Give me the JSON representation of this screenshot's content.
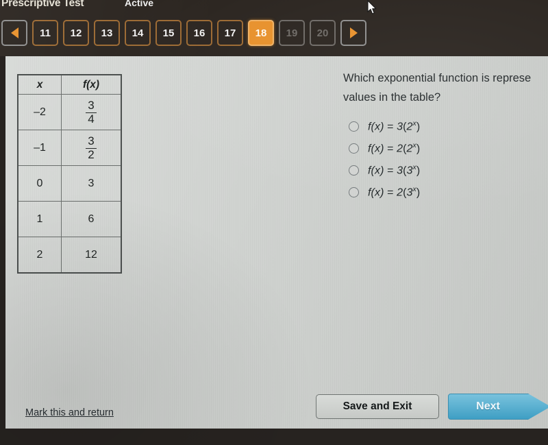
{
  "header": {
    "test_title": "Prescriptive Test",
    "status": "Active"
  },
  "pager": {
    "prev_label": "prev",
    "next_label": "next",
    "items": [
      {
        "label": "11",
        "state": "available"
      },
      {
        "label": "12",
        "state": "available"
      },
      {
        "label": "13",
        "state": "available"
      },
      {
        "label": "14",
        "state": "available"
      },
      {
        "label": "15",
        "state": "available"
      },
      {
        "label": "16",
        "state": "available"
      },
      {
        "label": "17",
        "state": "available"
      },
      {
        "label": "18",
        "state": "current"
      },
      {
        "label": "19",
        "state": "disabled"
      },
      {
        "label": "20",
        "state": "disabled"
      }
    ]
  },
  "table": {
    "headers": [
      "x",
      "f(x)"
    ],
    "rows": [
      {
        "x": "–2",
        "fx_num": "3",
        "fx_den": "4",
        "fx_plain": ""
      },
      {
        "x": "–1",
        "fx_num": "3",
        "fx_den": "2",
        "fx_plain": ""
      },
      {
        "x": "0",
        "fx_num": "",
        "fx_den": "",
        "fx_plain": "3"
      },
      {
        "x": "1",
        "fx_num": "",
        "fx_den": "",
        "fx_plain": "6"
      },
      {
        "x": "2",
        "fx_num": "",
        "fx_den": "",
        "fx_plain": "12"
      }
    ]
  },
  "question": {
    "line1": "Which exponential function is represe",
    "line2": "values in the table?",
    "choices": [
      {
        "id": "a",
        "coefficient": "3",
        "base": "2",
        "selected": false
      },
      {
        "id": "b",
        "coefficient": "2",
        "base": "2",
        "selected": false
      },
      {
        "id": "c",
        "coefficient": "3",
        "base": "3",
        "selected": false
      },
      {
        "id": "d",
        "coefficient": "2",
        "base": "3",
        "selected": false
      }
    ]
  },
  "footer": {
    "mark_link": "Mark this and return",
    "save_exit": "Save and Exit",
    "next": "Next"
  },
  "colors": {
    "accent_orange": "#e8912c",
    "next_blue": "#5bafd0",
    "page_bg": "#cfd2cf",
    "topbar_bg": "#2b2520"
  }
}
